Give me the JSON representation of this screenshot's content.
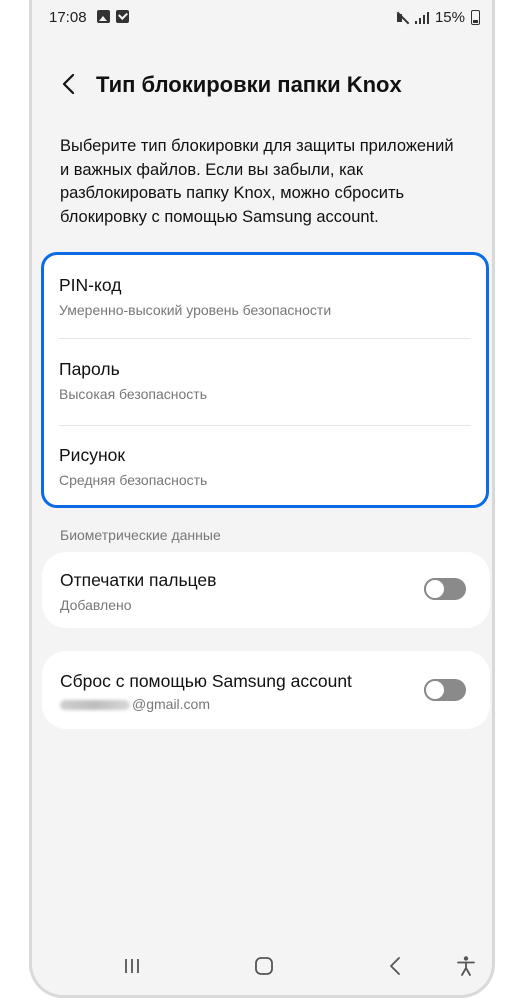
{
  "status_bar": {
    "time": "17:08",
    "battery": "15%",
    "icons_left": [
      "image-icon",
      "check-icon"
    ],
    "icons_right": [
      "mute-icon",
      "signal-icon",
      "battery-icon"
    ]
  },
  "header": {
    "title": "Тип блокировки папки Knox",
    "back_icon": "chevron-left-icon"
  },
  "description": "Выберите тип блокировки для защиты приложений и важных файлов. Если вы забыли, как разблокировать папку Knox, можно сбросить блокировку с помощью Samsung account.",
  "lock_types": [
    {
      "title": "PIN-код",
      "subtitle": "Умеренно-высокий уровень безопасности"
    },
    {
      "title": "Пароль",
      "subtitle": "Высокая безопасность"
    },
    {
      "title": "Рисунок",
      "subtitle": "Средняя безопасность"
    }
  ],
  "highlight_color": "#0b6be6",
  "biometrics": {
    "section_label": "Биометрические данные",
    "fingerprints": {
      "title": "Отпечатки пальцев",
      "subtitle": "Добавлено",
      "enabled": false
    }
  },
  "reset": {
    "title": "Сброс с помощью Samsung account",
    "email_suffix": "@gmail.com",
    "enabled": false
  },
  "nav_bar": {
    "icons": [
      "recent-apps-icon",
      "home-icon",
      "back-nav-icon",
      "accessibility-icon"
    ]
  }
}
